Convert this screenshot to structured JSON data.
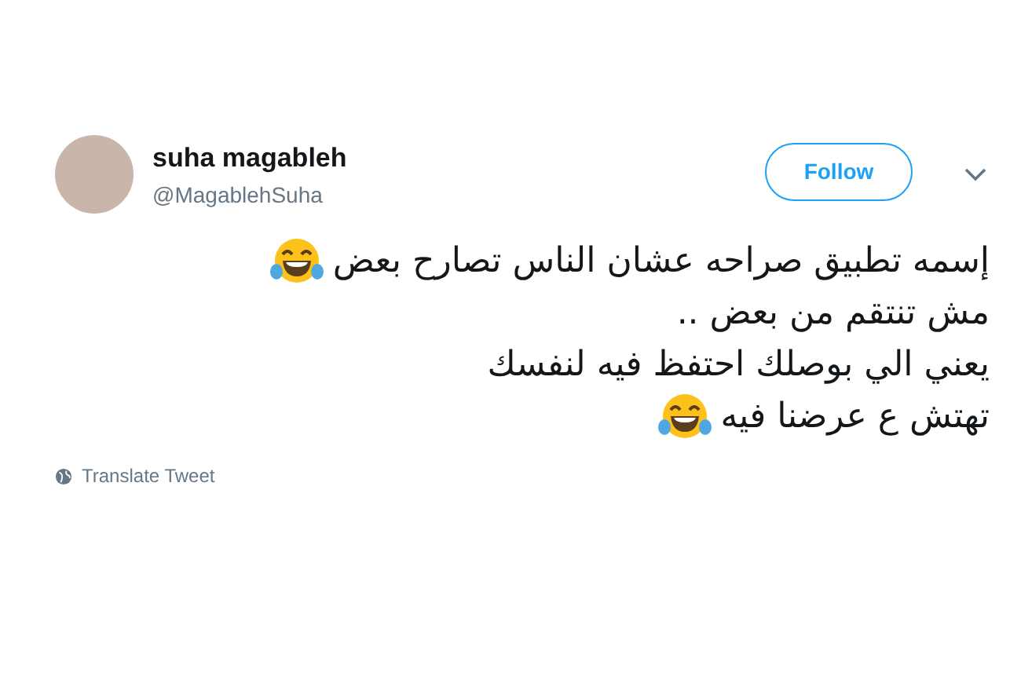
{
  "author": {
    "name": "suha magableh",
    "handle": "@MagablehSuha"
  },
  "follow_button": {
    "label": "Follow"
  },
  "tweet_lines": [
    {
      "text": "إسمه تطبيق صراحه عشان الناس تصارح بعض",
      "trailing_emoji": true
    },
    {
      "text": "مش تنتقم من بعض ..",
      "trailing_emoji": false
    },
    {
      "text": "يعني الي بوصلك احتفظ فيه لنفسك",
      "trailing_emoji": false
    },
    {
      "text": "تهتش ع عرضنا فيه",
      "trailing_emoji": true
    }
  ],
  "translate_link": "Translate Tweet"
}
